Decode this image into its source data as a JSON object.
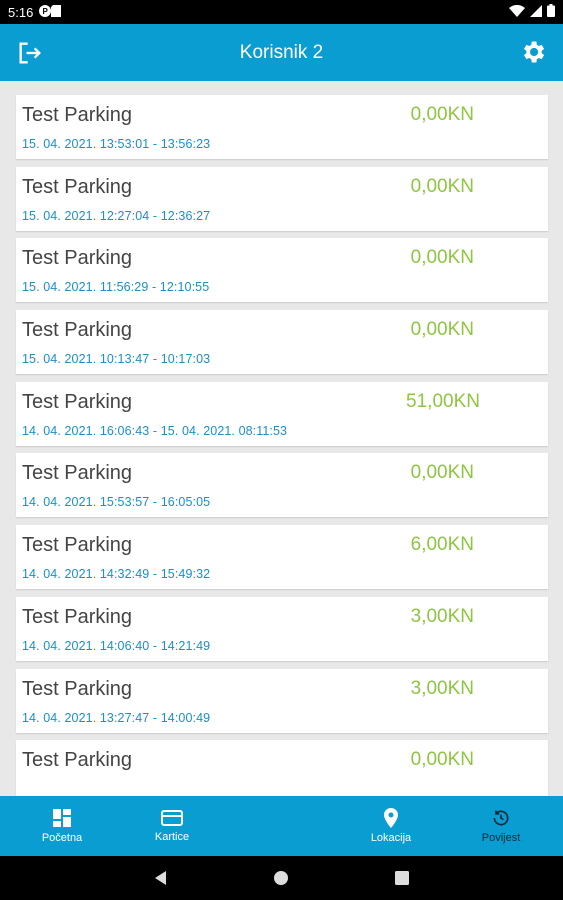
{
  "status_bar": {
    "time": "5:16"
  },
  "app_bar": {
    "title": "Korisnik 2"
  },
  "history": [
    {
      "name": "Test Parking",
      "price": "0,00KN",
      "time": "15. 04. 2021. 13:53:01 - 13:56:23"
    },
    {
      "name": "Test Parking",
      "price": "0,00KN",
      "time": "15. 04. 2021. 12:27:04 - 12:36:27"
    },
    {
      "name": "Test Parking",
      "price": "0,00KN",
      "time": "15. 04. 2021. 11:56:29 - 12:10:55"
    },
    {
      "name": "Test Parking",
      "price": "0,00KN",
      "time": "15. 04. 2021. 10:13:47 - 10:17:03"
    },
    {
      "name": "Test Parking",
      "price": "51,00KN",
      "time": "14. 04. 2021. 16:06:43 - 15. 04. 2021. 08:11:53"
    },
    {
      "name": "Test Parking",
      "price": "0,00KN",
      "time": "14. 04. 2021. 15:53:57 - 16:05:05"
    },
    {
      "name": "Test Parking",
      "price": "6,00KN",
      "time": "14. 04. 2021. 14:32:49 - 15:49:32"
    },
    {
      "name": "Test Parking",
      "price": "3,00KN",
      "time": "14. 04. 2021. 14:06:40 - 14:21:49"
    },
    {
      "name": "Test Parking",
      "price": "3,00KN",
      "time": "14. 04. 2021. 13:27:47 - 14:00:49"
    },
    {
      "name": "Test Parking",
      "price": "0,00KN",
      "time": ""
    }
  ],
  "bottom_nav": {
    "home": "Početna",
    "cards": "Kartice",
    "location": "Lokacija",
    "history": "Povijest"
  },
  "colors": {
    "primary": "#0a9dd2",
    "price": "#8dc63f",
    "time": "#1a8fc9"
  },
  "icons": {
    "logout": "logout-icon",
    "settings": "gear-icon",
    "home": "dashboard-icon",
    "cards": "credit-card-icon",
    "location": "location-pin-icon",
    "history": "history-icon"
  }
}
